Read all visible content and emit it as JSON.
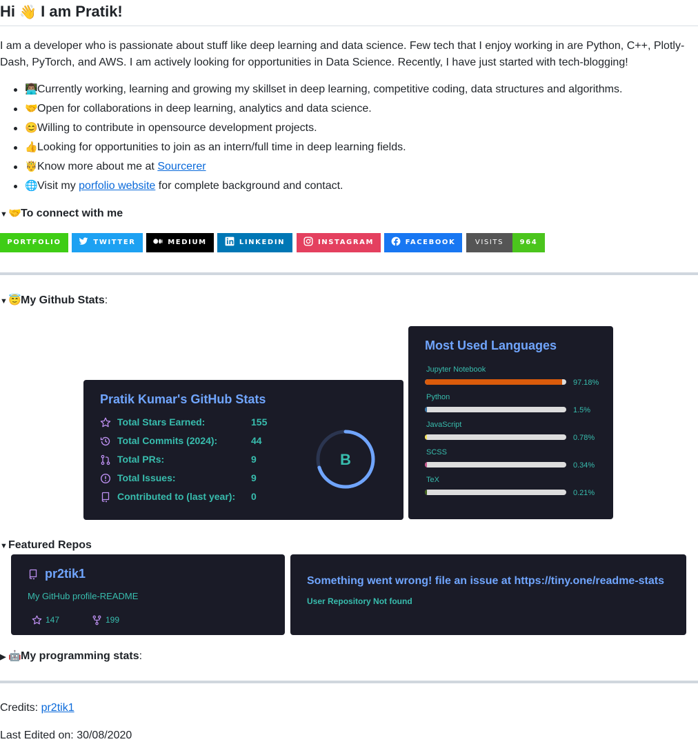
{
  "header": {
    "greeting": "Hi",
    "name": "I am Pratik!"
  },
  "intro": "I am a developer who is passionate about stuff like deep learning and data science. Few tech that I enjoy working in are Python, C++, Plotly-Dash, PyTorch, and AWS. I am actively looking for opportunities in Data Science. Recently, I have just started with tech-blogging!",
  "bullets": [
    {
      "emoji": "👨🏽‍💻",
      "text": "Currently working, learning and growing my skillset in deep learning, competitive coding, data structures and algorithms."
    },
    {
      "emoji": "🤝",
      "text": "Open for collaborations in deep learning, analytics and data science."
    },
    {
      "emoji": "😊",
      "text": "Willing to contribute in opensource development projects."
    },
    {
      "emoji": "👍",
      "text": "Looking for opportunities to join as an intern/full time in deep learning fields."
    },
    {
      "emoji": "🤴",
      "text_before": "Know more about me at ",
      "link": "Sourcerer"
    },
    {
      "emoji": "🌐",
      "text_before": "Visit my ",
      "link": "porfolio website",
      "text_after": " for complete background and contact."
    }
  ],
  "connect": {
    "emoji": "🤝",
    "title": "To connect with me"
  },
  "badges": {
    "portfolio": "PORTFOLIO",
    "twitter": "TWITTER",
    "medium": "MEDIUM",
    "linkedin": "LINKEDIN",
    "instagram": "INSTAGRAM",
    "facebook": "FACEBOOK",
    "visits_label": "VISITS",
    "visits_count": "964",
    "colors": {
      "portfolio": "#3fcd15",
      "twitter": "#1da1f2",
      "medium": "#000000",
      "linkedin": "#0077b5",
      "instagram": "#e4405f",
      "facebook": "#1877f2",
      "visits_label": "#555555",
      "visits_count": "#4bc51d"
    }
  },
  "github_stats_section": {
    "emoji": "😇",
    "title": "My Github Stats",
    "colon": ":"
  },
  "stats_card": {
    "title": "Pratik Kumar's GitHub Stats",
    "rows": [
      {
        "icon": "star-icon",
        "label": "Total Stars Earned:",
        "value": "155"
      },
      {
        "icon": "history-icon",
        "label": "Total Commits (2024):",
        "value": "44"
      },
      {
        "icon": "pull-request-icon",
        "label": "Total PRs:",
        "value": "9"
      },
      {
        "icon": "issue-icon",
        "label": "Total Issues:",
        "value": "9"
      },
      {
        "icon": "repo-icon",
        "label": "Contributed to (last year):",
        "value": "0"
      }
    ],
    "rank": "B",
    "rank_progress": 0.3,
    "colors": {
      "bg": "#1a1b27",
      "title": "#70a5fd",
      "text": "#38bdae",
      "icon": "#bf91f3"
    }
  },
  "languages_card": {
    "title": "Most Used Languages",
    "languages": [
      {
        "name": "Jupyter Notebook",
        "percent": "97.18%",
        "value": 97.18,
        "color": "#da5b0b"
      },
      {
        "name": "Python",
        "percent": "1.5%",
        "value": 1.5,
        "color": "#3572a5"
      },
      {
        "name": "JavaScript",
        "percent": "0.78%",
        "value": 0.78,
        "color": "#f1e05a"
      },
      {
        "name": "SCSS",
        "percent": "0.34%",
        "value": 0.34,
        "color": "#c6538c"
      },
      {
        "name": "TeX",
        "percent": "0.21%",
        "value": 0.21,
        "color": "#3d6117"
      }
    ]
  },
  "featured_section": {
    "title": "Featured Repos"
  },
  "repo_card": {
    "name": "pr2tik1",
    "description": "My GitHub profile-README",
    "stars": "147",
    "forks": "199"
  },
  "error_card": {
    "message": "Something went wrong! file an issue at https://tiny.one/readme-stats",
    "detail": "User Repository Not found"
  },
  "programming_section": {
    "emoji": "🤖",
    "title": "My programming stats",
    "colon": ":"
  },
  "footer": {
    "credits_label": "Credits: ",
    "credits_link": "pr2tik1",
    "last_edited": "Last Edited on: 30/08/2020"
  }
}
